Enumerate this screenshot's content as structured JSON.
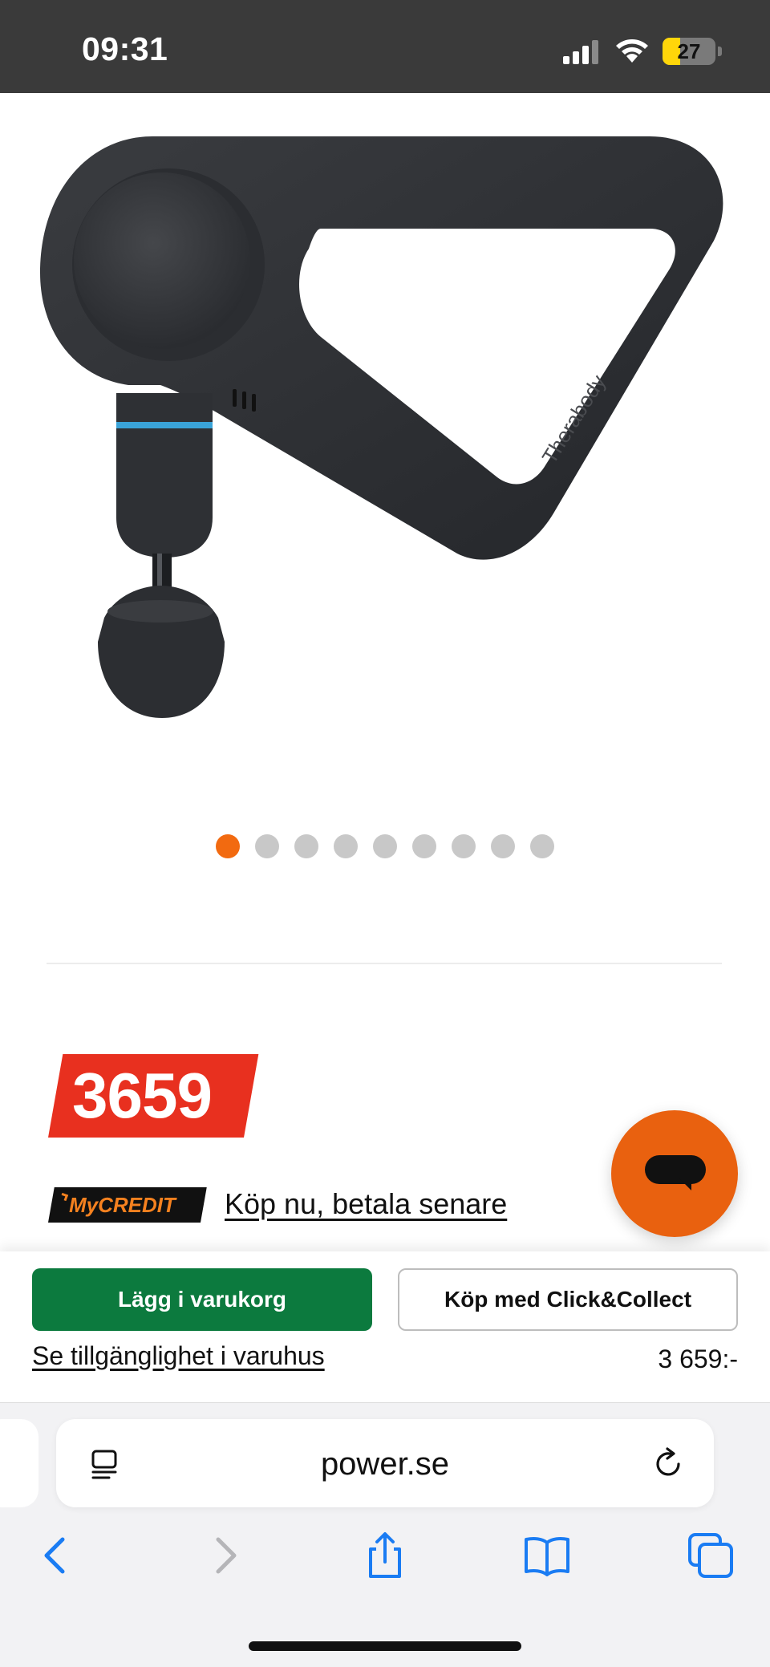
{
  "status_bar": {
    "time": "09:31",
    "battery_level": "27",
    "icons": [
      "cellular-signal-icon",
      "wifi-icon",
      "battery-icon"
    ]
  },
  "product": {
    "image_icon": "massage-gun-image",
    "image_brand_text": "Therabody",
    "carousel": {
      "count": 9,
      "active_index": 0
    }
  },
  "price": {
    "amount": "3659"
  },
  "credit": {
    "logo_text": "MyCREDIT",
    "link_label": "Köp nu, betala senare"
  },
  "chat": {
    "icon": "chat-icon"
  },
  "buy_bar": {
    "add_to_cart_label": "Lägg i varukorg",
    "click_collect_label": "Köp med Click&Collect",
    "store_availability_label": "Se tillgänglighet i varuhus",
    "price_label": "3 659:-"
  },
  "browser": {
    "url": "power.se",
    "toolbar_icons": [
      "back-icon",
      "forward-icon",
      "share-icon",
      "bookmarks-icon",
      "tabs-icon"
    ]
  },
  "colors": {
    "accent_orange": "#f26a10",
    "price_red": "#e8301f",
    "cart_green": "#0c7a3e",
    "ios_blue": "#1a7cf3"
  }
}
